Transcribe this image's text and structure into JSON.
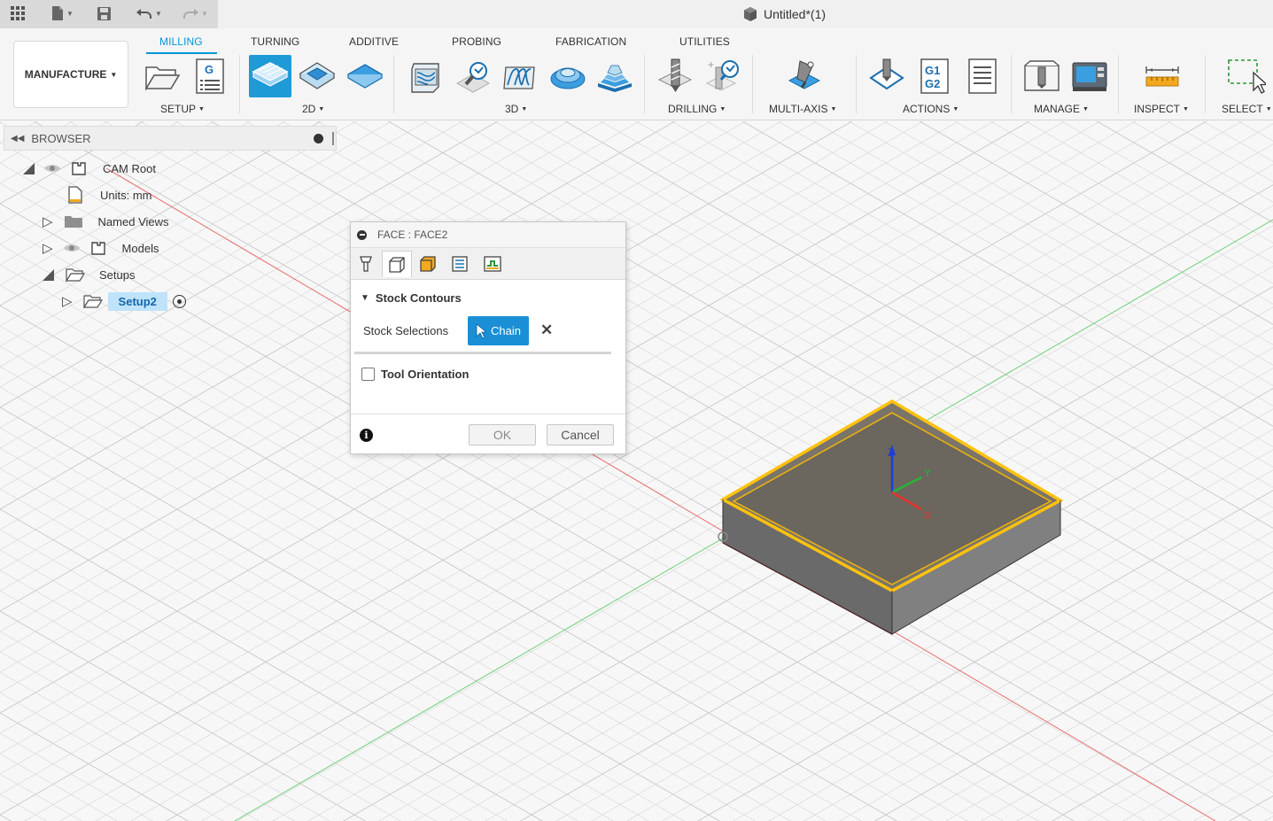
{
  "app": {
    "doc_title": "Untitled*(1)",
    "workspace": "MANUFACTURE"
  },
  "ribbon": {
    "tabs": [
      "MILLING",
      "TURNING",
      "ADDITIVE",
      "PROBING",
      "FABRICATION",
      "UTILITIES"
    ],
    "active_tab": "MILLING",
    "groups": [
      "SETUP",
      "2D",
      "3D",
      "DRILLING",
      "MULTI-AXIS",
      "ACTIONS",
      "MANAGE",
      "INSPECT",
      "SELECT"
    ]
  },
  "browser": {
    "title": "BROWSER",
    "items": [
      {
        "label": "CAM Root"
      },
      {
        "label": "Units: mm"
      },
      {
        "label": "Named Views"
      },
      {
        "label": "Models"
      },
      {
        "label": "Setups"
      },
      {
        "label": "Setup2"
      }
    ]
  },
  "dialog": {
    "title": "FACE : FACE2",
    "section_title": "Stock Contours",
    "stock_label": "Stock Selections",
    "chain_label": "Chain",
    "tool_orientation_label": "Tool Orientation",
    "tool_orientation_checked": false,
    "ok_label": "OK",
    "cancel_label": "Cancel"
  },
  "axes": {
    "z": "Z",
    "y": "Y",
    "x": "X"
  },
  "colors": {
    "accent": "#0696d7",
    "active_tool": "#1e9bd7",
    "selection_edge": "#ffc20e",
    "axis_x": "#e8332a",
    "axis_y": "#26b637",
    "axis_z": "#1e3fd6"
  },
  "icons": [
    "apps-grid-icon",
    "file-icon",
    "save-icon",
    "undo-icon",
    "redo-icon",
    "document-cube-icon",
    "eye-icon",
    "component-icon",
    "folder-icon",
    "target-icon",
    "info-icon",
    "close-icon",
    "cursor-icon"
  ]
}
